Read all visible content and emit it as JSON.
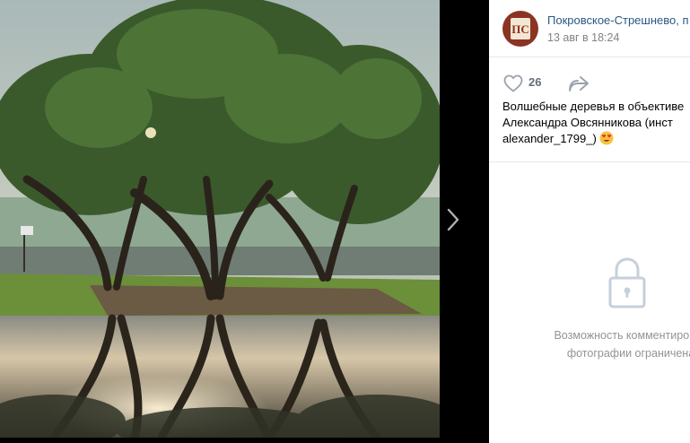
{
  "post": {
    "author_name": "Покровское-Стрешнево, п",
    "date": "13 авг в 18:24",
    "avatar_text": "ПС",
    "likes": "26",
    "caption": "Волшебные деревья в объективе Александра Овсянникова (инст alexander_1799_)"
  },
  "comments": {
    "locked_line1": "Возможность комментирован",
    "locked_line2": "фотографии ограничена"
  },
  "icons": {
    "like": "heart-icon",
    "share": "share-arrow-icon",
    "next": "chevron-right-icon",
    "lock": "lock-icon",
    "emoji": "heart-eyes-emoji"
  },
  "colors": {
    "link": "#2a5885",
    "muted": "#828282",
    "lock_gray": "#c5d0db"
  }
}
